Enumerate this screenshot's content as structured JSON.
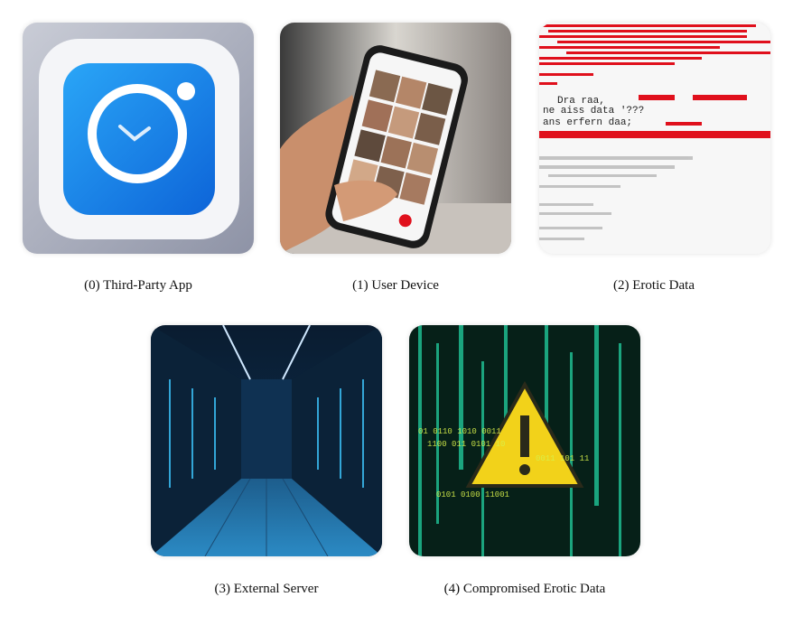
{
  "items": [
    {
      "caption": "(0) Third-Party App"
    },
    {
      "caption": "(1) User Device"
    },
    {
      "caption": "(2) Erotic Data",
      "glitch_lines": [
        "ne aiss data '???",
        "ans erfern daa;",
        "Dra raa,"
      ]
    },
    {
      "caption": "(3) External Server"
    },
    {
      "caption": "(4) Compromised Erotic Data"
    }
  ],
  "colors": {
    "app_blue": "#1a84e6",
    "glitch_red": "#e0101c",
    "warning_yellow": "#f2d21a",
    "matrix_green": "#22d0a0",
    "server_blue": "#0a2a4a"
  }
}
